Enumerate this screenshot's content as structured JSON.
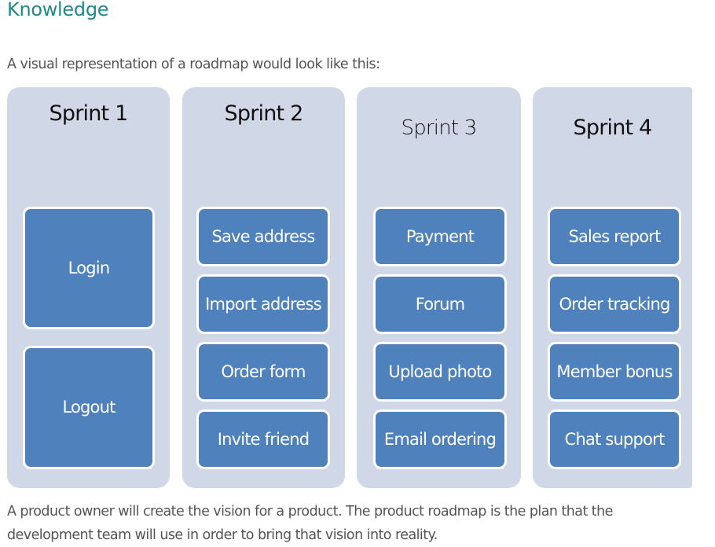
{
  "page": {
    "heading": "Knowledge",
    "intro": "A visual representation of a roadmap would look like this:",
    "outro": "A product owner will create the vision for a product. The product roadmap is the plan that the development team will use in order to bring that vision into reality."
  },
  "colors": {
    "heading": "#1e8a8c",
    "body_text": "#545454",
    "column_bg": "#d0d8e8",
    "item_fill": "#4f81bd",
    "item_border": "#ffffff",
    "item_text": "#ffffff"
  },
  "roadmap": {
    "sprints": [
      {
        "title": "Sprint 1",
        "items": [
          "Login",
          "Logout"
        ]
      },
      {
        "title": "Sprint 2",
        "items": [
          "Save address",
          "Import address",
          "Order form",
          "Invite friend"
        ]
      },
      {
        "title": "Sprint 3",
        "items": [
          "Payment",
          "Forum",
          "Upload photo",
          "Email ordering"
        ]
      },
      {
        "title": "Sprint 4",
        "items": [
          "Sales report",
          "Order tracking",
          "Member bonus",
          "Chat support"
        ]
      }
    ]
  }
}
